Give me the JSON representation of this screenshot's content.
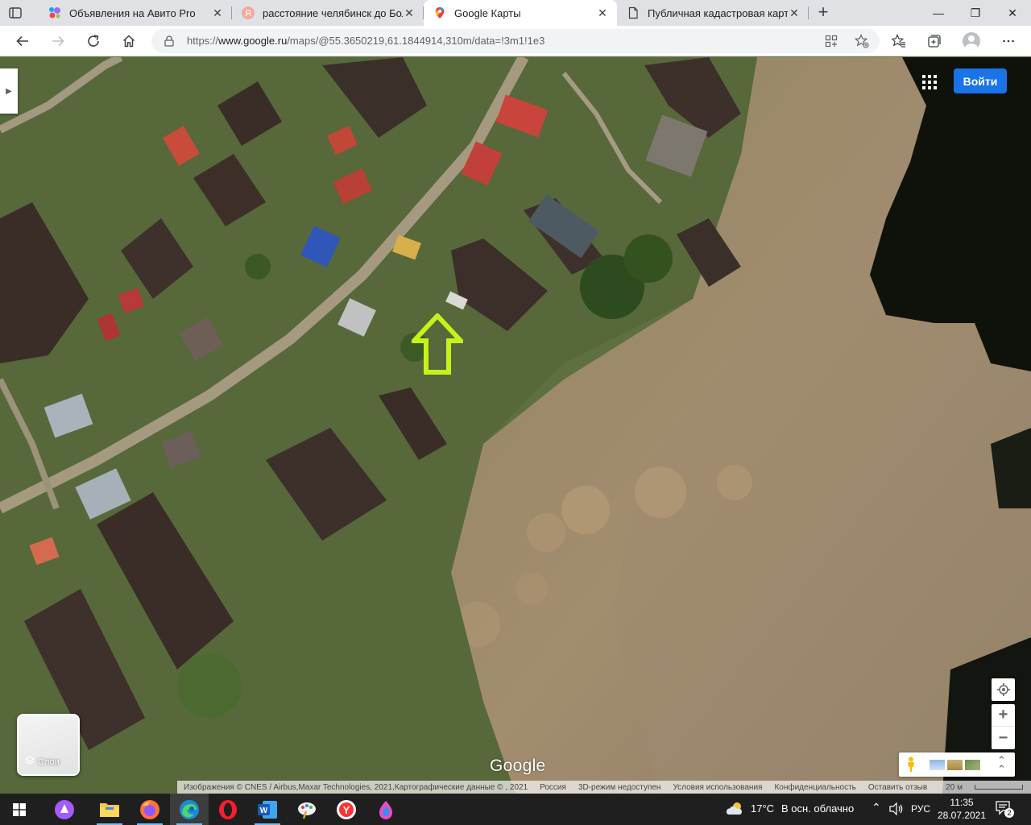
{
  "browser": {
    "tabs": [
      {
        "title": "Объявления на Авито Pro",
        "icon": "avito-favicon",
        "active": false
      },
      {
        "title": "расстояние челябинск до Больш",
        "icon": "yandex-favicon",
        "active": false
      },
      {
        "title": "Google Карты",
        "icon": "google-maps-favicon",
        "active": true
      },
      {
        "title": "Публичная кадастровая карта Ч",
        "icon": "page-favicon",
        "active": false
      }
    ],
    "new_tab_symbol": "+",
    "window_controls": {
      "minimize": "—",
      "restore": "❐",
      "close": "✕"
    },
    "address": {
      "scheme": "https://",
      "host": "www.google.ru",
      "path": "/maps/@55.3650219,61.1844914,310m/data=!3m1!1e3"
    }
  },
  "maps": {
    "signin_label": "Войти",
    "layers_label": "Слои",
    "zoom_in": "+",
    "zoom_out": "−",
    "logo_text": "Google",
    "expand_symbol": "⌃",
    "attribution": {
      "imagery": "Изображения © CNES / Airbus,Maxar Technologies, 2021,Картографические данные © , 2021",
      "country": "Россия",
      "mode_3d": "3D-режим недоступен",
      "terms": "Условия использования",
      "privacy": "Конфиденциальность",
      "feedback": "Оставить отзыв",
      "scale": "20 м"
    },
    "marker": {
      "type": "arrow-up",
      "color": "#c6f21b"
    }
  },
  "taskbar": {
    "weather": {
      "temp": "17°C",
      "desc": "В осн. облачно"
    },
    "language": "РУС",
    "time": "11:35",
    "date": "28.07.2021",
    "notifications": "2",
    "apps": [
      "start",
      "alice",
      "file-explorer",
      "firefox",
      "edge",
      "opera",
      "word",
      "paint",
      "yandex-browser",
      "color-app"
    ]
  },
  "colors": {
    "map_signin": "#1a73e8",
    "taskbar": "#1f1f1f",
    "tabstrip": "#dfe1e5"
  }
}
